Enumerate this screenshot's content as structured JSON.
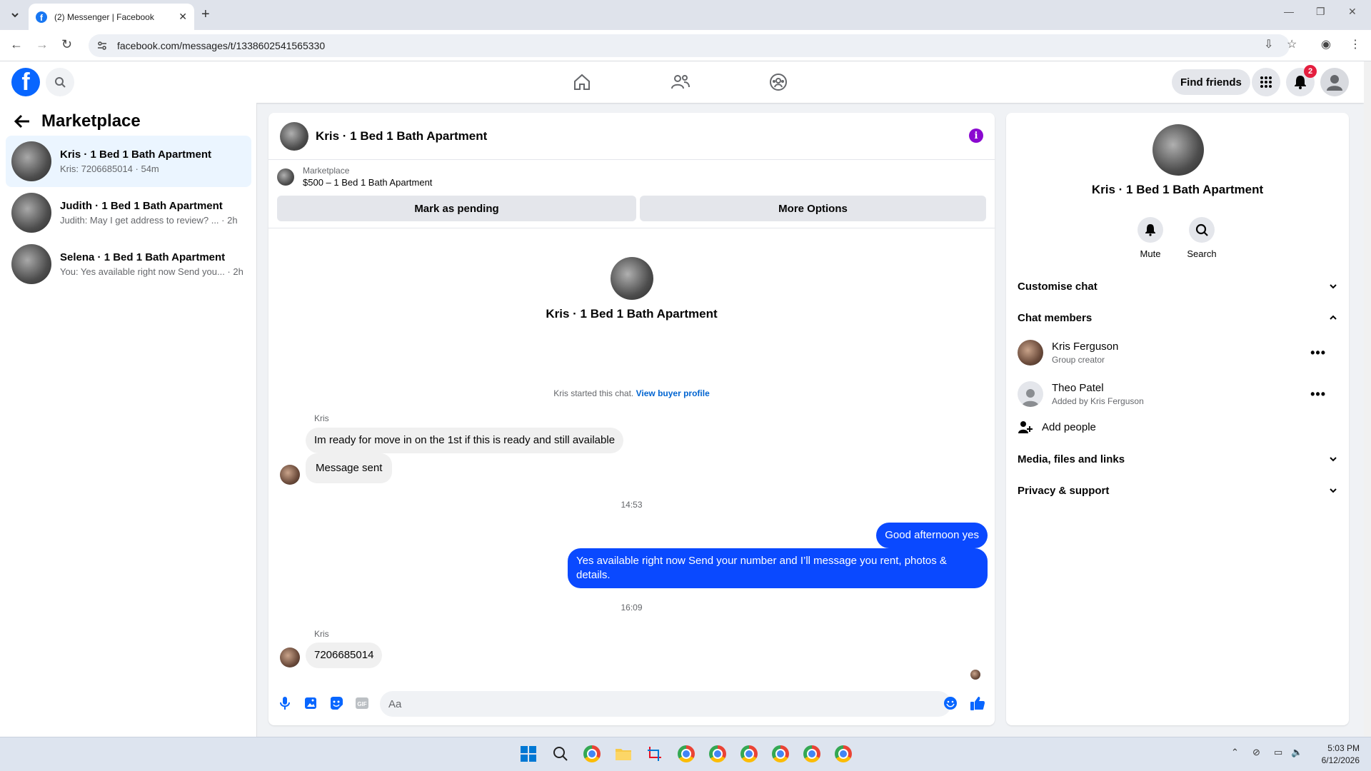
{
  "browser": {
    "tab_title": "(2) Messenger | Facebook",
    "url": "facebook.com/messages/t/1338602541565330"
  },
  "header": {
    "find_friends": "Find friends",
    "notification_count": "2"
  },
  "sidebar": {
    "title": "Marketplace",
    "conversations": [
      {
        "name": "Kris · 1 Bed 1 Bath Apartment",
        "preview": "Kris: 7206685014 · 54m"
      },
      {
        "name": "Judith · 1 Bed 1 Bath Apartment",
        "preview": "Judith: May I get address to review? ... · 2h"
      },
      {
        "name": "Selena · 1 Bed 1 Bath Apartment",
        "preview": "You: Yes available right now Send you... · 2h"
      }
    ]
  },
  "chat": {
    "title": "Kris · 1 Bed 1 Bath Apartment",
    "listing_label": "Marketplace",
    "listing_value": "$500 – 1 Bed 1 Bath Apartment",
    "mark_pending": "Mark as pending",
    "more_options": "More Options",
    "intro_name": "Kris · 1 Bed 1 Bath Apartment",
    "started_text": "Kris started this chat.",
    "started_link": "View buyer profile",
    "messages": [
      {
        "sender": "Kris",
        "text": "Im ready for move in on the 1st if this is ready and still available"
      },
      {
        "text": "Message sent"
      },
      {
        "time": "14:53"
      },
      {
        "text": "Good afternoon yes"
      },
      {
        "text": "Yes available right now Send your number and I’ll message you rent, photos & details."
      },
      {
        "time": "16:09"
      },
      {
        "sender": "Kris",
        "text": "7206685014"
      }
    ],
    "composer_placeholder": "Aa"
  },
  "details": {
    "name": "Kris · 1 Bed 1 Bath Apartment",
    "mute": "Mute",
    "search": "Search",
    "customise_chat": "Customise chat",
    "chat_members": "Chat members",
    "members": [
      {
        "name": "Kris Ferguson",
        "sub": "Group creator"
      },
      {
        "name": "Theo Patel",
        "sub": "Added by Kris Ferguson"
      }
    ],
    "add_people": "Add people",
    "media": "Media, files and links",
    "privacy": "Privacy & support"
  },
  "taskbar": {
    "time": "5:03 PM",
    "date": "6/12/2026"
  },
  "colors": {
    "brand": "#0866ff",
    "outgoing_bubble": "#0a49ff",
    "active_conversation": "#ebf5ff",
    "info_icon": "#8a08d0"
  }
}
